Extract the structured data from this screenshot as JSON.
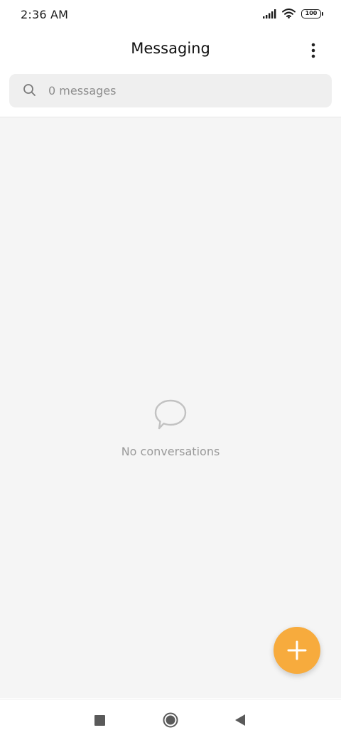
{
  "status_bar": {
    "time": "2:36 AM",
    "battery_level": "100",
    "icons": [
      "signal-icon",
      "wifi-icon",
      "battery-icon"
    ]
  },
  "header": {
    "title": "Messaging",
    "menu_icon": "more-vertical-icon"
  },
  "search": {
    "placeholder": "0 messages",
    "icon": "search-icon"
  },
  "empty_state": {
    "icon": "speech-bubble-icon",
    "text": "No conversations"
  },
  "fab": {
    "icon": "plus-icon",
    "color": "#f7ab3d"
  },
  "nav_bar": {
    "icons": [
      "recents-square-icon",
      "home-circle-icon",
      "back-triangle-icon"
    ]
  },
  "colors": {
    "accent": "#f7ab3d",
    "background": "#f5f5f5",
    "search_background": "#efefef"
  }
}
